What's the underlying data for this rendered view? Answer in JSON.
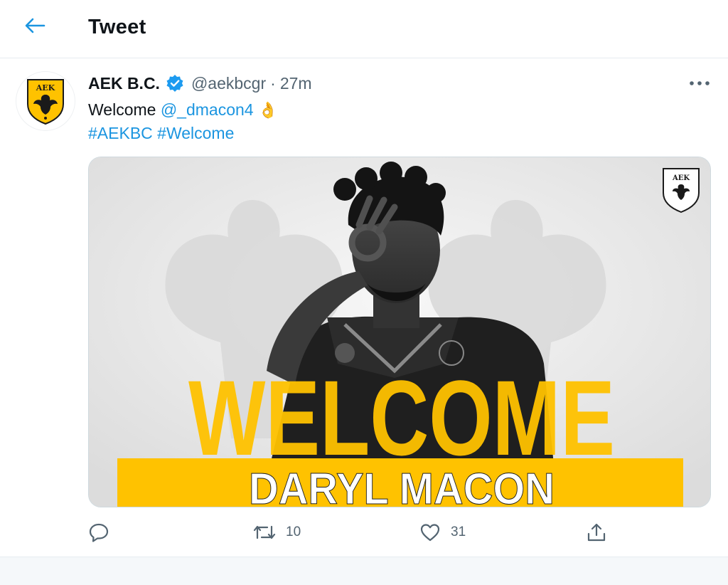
{
  "header": {
    "title": "Tweet",
    "back_icon": "arrow-left-icon"
  },
  "tweet": {
    "author": {
      "name": "AEK B.C.",
      "handle": "@aekbcgr",
      "verified": true,
      "avatar_text": "ΑΕΚ"
    },
    "separator": "·",
    "time": "27m",
    "text": {
      "welcome": "Welcome",
      "mention": "@_dmacon4",
      "emoji": "👌",
      "hashtag_1": "#AEKBC",
      "hashtag_2": "#Welcome"
    },
    "media": {
      "headline": "WELCOME",
      "player_name": "DARYL MACON",
      "badge_text": "ΑΕΚ"
    },
    "actions": {
      "reply_icon": "reply-icon",
      "retweet_count": "10",
      "like_count": "31",
      "share_icon": "share-icon"
    }
  },
  "colors": {
    "accent": "#1b95e0",
    "verified": "#1d9bf0",
    "brand_yellow": "#ffc200",
    "text_secondary": "#536471"
  }
}
